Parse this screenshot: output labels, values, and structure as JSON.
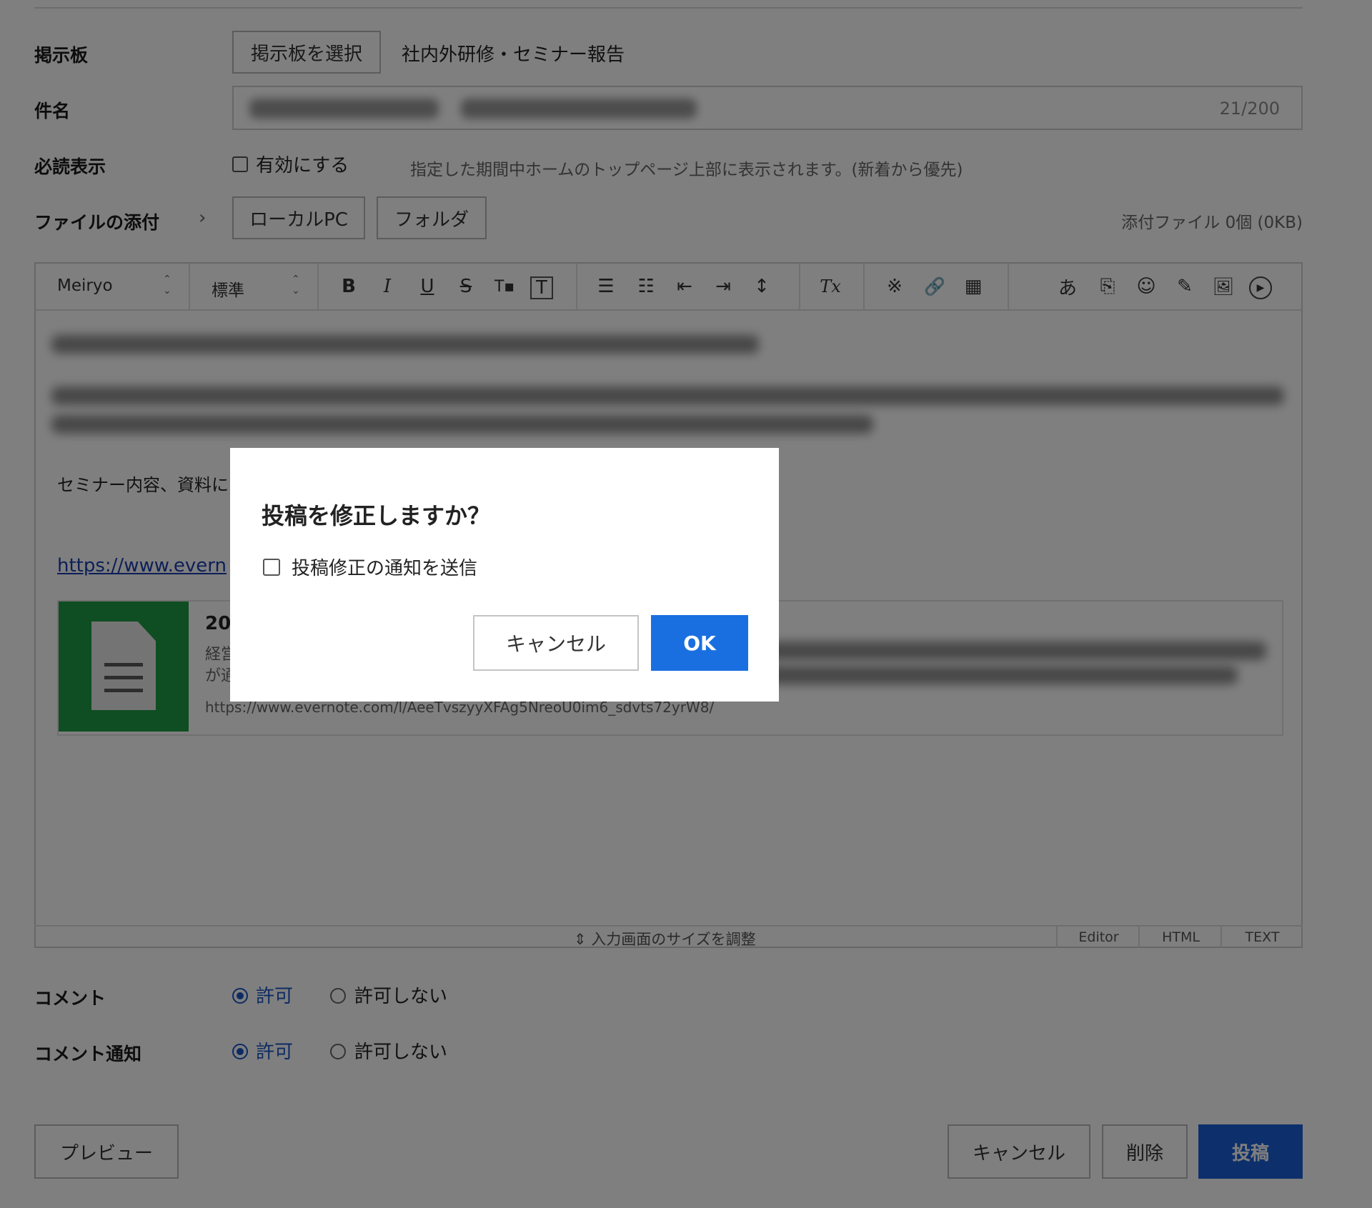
{
  "form": {
    "board": {
      "label": "掲示板",
      "select_button": "掲示板を選択",
      "value": "社内外研修・セミナー報告"
    },
    "subject": {
      "label": "件名",
      "char_count": "21/200"
    },
    "pinned": {
      "label": "必読表示",
      "checkbox_label": "有効にする",
      "hint": "指定した期間中ホームのトップページ上部に表示されます。(新着から優先)"
    },
    "attachment": {
      "label": "ファイルの添付",
      "chevron": "›",
      "local_button": "ローカルPC",
      "folder_button": "フォルダ",
      "summary": "添付ファイル 0個 (0KB)"
    }
  },
  "editor": {
    "font_select": "Meiryo",
    "size_select": "標準",
    "updown": "⌃\n⌄",
    "toolbar_glyphs": {
      "bold": "B",
      "italic": "I",
      "underline": "U",
      "strike": "S",
      "text_color": "T▪",
      "text_bg": "T",
      "align": "☰",
      "bullet": "☷",
      "outdent": "⇤",
      "indent": "⇥",
      "line_height": "↕",
      "clear_format": "Tx",
      "special_char": "※",
      "link": "🔗",
      "table": "▦",
      "font_effect": "あ",
      "template": "⎘",
      "emoji": "☺",
      "image_edit": "✎",
      "image": "🖼",
      "video": "▶"
    },
    "body_line": "セミナー内容、資料に",
    "link_text": "https://www.evern",
    "card_title_partial": "20",
    "card_desc_line1_partial": "経営",
    "card_desc_line2_partial": "が通",
    "card_url": "https://www.evernote.com/l/AeeTvszyyXFAg5NreoU0im6_sdvts72yrW8/",
    "resize_text": "⇕ 入力画面のサイズを調整",
    "tabs": [
      "Editor",
      "HTML",
      "TEXT"
    ]
  },
  "comment": {
    "label": "コメント",
    "allow": "許可",
    "deny": "許可しない",
    "selected": "allow"
  },
  "comment_notify": {
    "label": "コメント通知",
    "allow": "許可",
    "deny": "許可しない",
    "selected": "allow"
  },
  "footer": {
    "preview": "プレビュー",
    "cancel": "キャンセル",
    "delete": "削除",
    "post": "投稿"
  },
  "modal": {
    "title": "投稿を修正しますか？",
    "checkbox_label": "投稿修正の通知を送信",
    "cancel": "キャンセル",
    "ok": "OK"
  },
  "colors": {
    "primary": "#1a61d8",
    "modal_ok": "#1a6fe0",
    "overlay": "rgba(0,0,0,0.5)",
    "evernote_green": "#1f9d44"
  }
}
